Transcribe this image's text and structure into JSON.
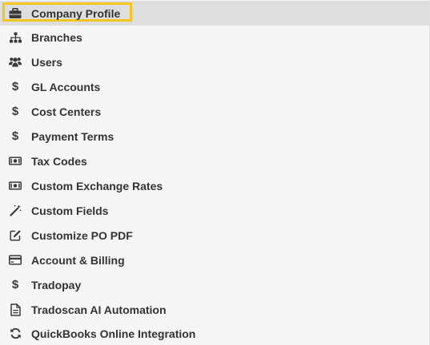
{
  "menu": {
    "items": [
      {
        "label": "Company Profile",
        "icon": "briefcase-icon",
        "active": true
      },
      {
        "label": "Branches",
        "icon": "sitemap-icon"
      },
      {
        "label": "Users",
        "icon": "users-icon"
      },
      {
        "label": "GL Accounts",
        "icon": "dollar-icon"
      },
      {
        "label": "Cost Centers",
        "icon": "dollar-icon"
      },
      {
        "label": "Payment Terms",
        "icon": "dollar-icon"
      },
      {
        "label": "Tax Codes",
        "icon": "money-bill-icon"
      },
      {
        "label": "Custom Exchange Rates",
        "icon": "money-bill-icon"
      },
      {
        "label": "Custom Fields",
        "icon": "magic-wand-icon"
      },
      {
        "label": "Customize PO PDF",
        "icon": "edit-icon"
      },
      {
        "label": "Account & Billing",
        "icon": "credit-card-icon"
      },
      {
        "label": "Tradopay",
        "icon": "dollar-icon"
      },
      {
        "label": "Tradoscan AI Automation",
        "icon": "document-icon"
      },
      {
        "label": "QuickBooks Online Integration",
        "icon": "sync-icon"
      }
    ]
  },
  "colors": {
    "active_background": "#dedede",
    "highlight_border": "#f3c51d",
    "text": "#333333"
  }
}
